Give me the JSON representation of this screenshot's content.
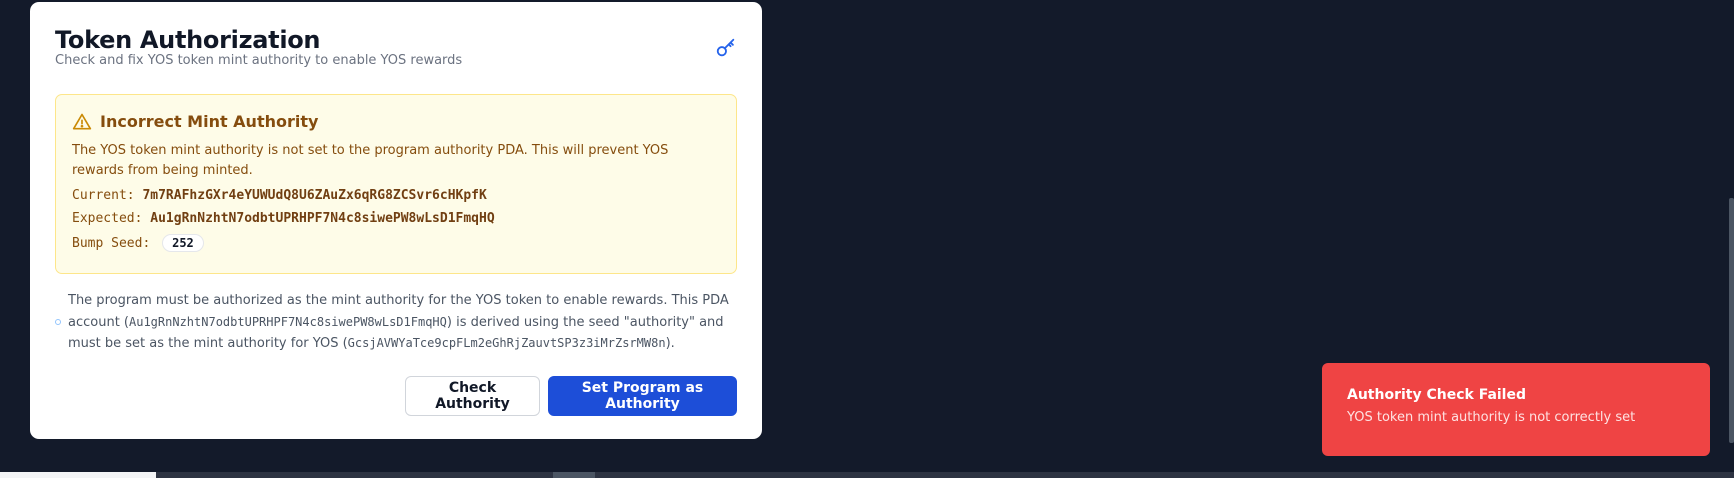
{
  "modal": {
    "title": "Token Authorization",
    "subtitle": "Check and fix YOS token mint authority to enable YOS rewards",
    "header_icon": "key-icon"
  },
  "alert": {
    "icon": "warning-triangle-icon",
    "title": "Incorrect Mint Authority",
    "description": "The YOS token mint authority is not set to the program authority PDA. This will prevent YOS rewards from being minted.",
    "current_label": "Current:",
    "current_value": "7m7RAFhzGXr4eYUWUdQ8U6ZAuZx6qRG8ZCSvr6cHKpfK",
    "expected_label": "Expected:",
    "expected_value": "Au1gRnNzhtN7odbtUPRHPF7N4c8siwePW8wLsD1FmqHQ",
    "bump_label": "Bump Seed:",
    "bump_value": "252"
  },
  "info": {
    "text_1": "The program must be authorized as the mint authority for the YOS token to enable rewards. This PDA account (",
    "pda": "Au1gRnNzhtN7odbtUPRHPF7N4c8siwePW8wLsD1FmqHQ",
    "text_2": ") is derived using the seed \"authority\" and must be set as the mint authority for YOS (",
    "mint": "GcsjAVWYaTce9cpFLm2eGhRjZauvtSP3z3iMrZsrMW8n",
    "text_3": ")."
  },
  "buttons": {
    "check": "Check Authority",
    "set": "Set Program as Authority"
  },
  "toast": {
    "title": "Authority Check Failed",
    "description": "YOS token mint authority is not correctly set"
  },
  "colors": {
    "background": "#131a2a",
    "primary": "#1d4ed8",
    "warning_bg": "#fefce8",
    "warning_text": "#854d0e",
    "error": "#ef4444"
  }
}
